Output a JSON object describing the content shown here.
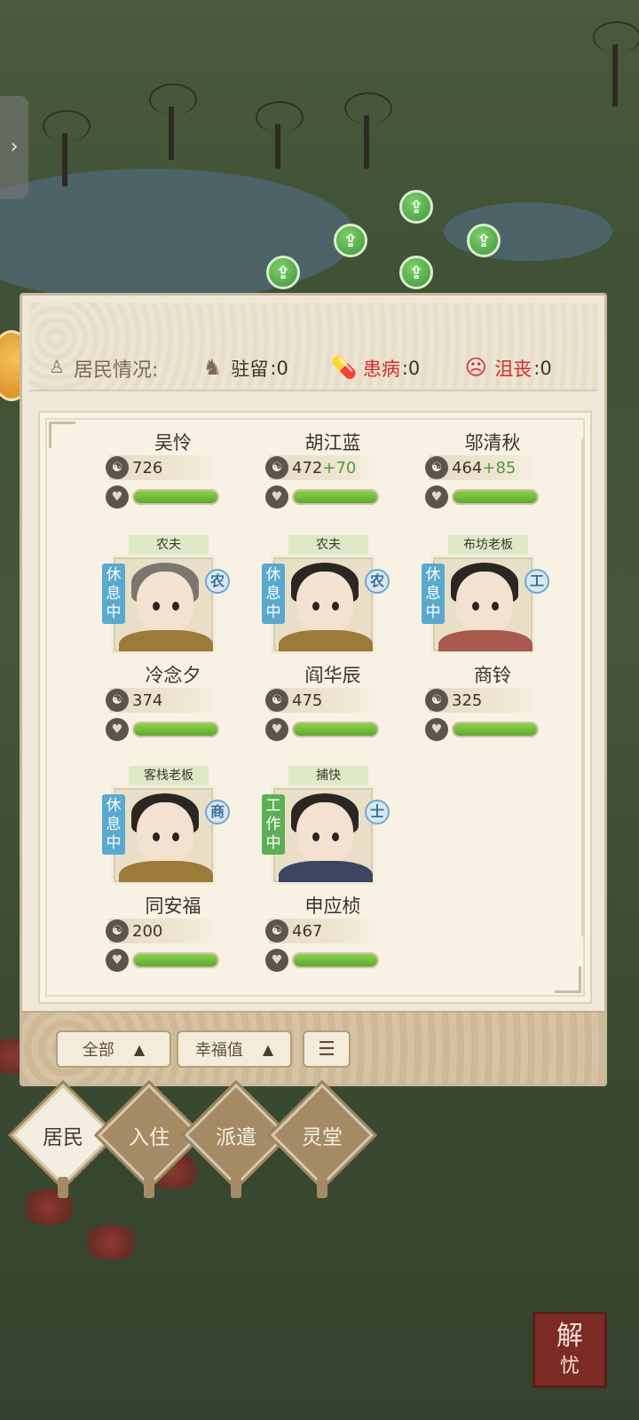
{
  "status": {
    "title": "居民情况:",
    "stay": {
      "label": "驻留",
      "value": ":0"
    },
    "sick": {
      "label": "患病",
      "value": ":0"
    },
    "sad": {
      "label": "沮丧",
      "value": ":0"
    }
  },
  "residents_top": [
    {
      "name": "吴怜",
      "happiness": "726",
      "bonus": "",
      "health": 1.0
    },
    {
      "name": "胡江蓝",
      "happiness": "472",
      "bonus": "+70",
      "health": 1.0
    },
    {
      "name": "邬清秋",
      "happiness": "464",
      "bonus": "+85",
      "health": 1.0
    }
  ],
  "residents": [
    {
      "name": "冷念夕",
      "job": "农夫",
      "state": "休息中",
      "class": "农",
      "happiness": "374",
      "health": 1.0
    },
    {
      "name": "阎华辰",
      "job": "农夫",
      "state": "休息中",
      "class": "农",
      "happiness": "475",
      "health": 1.0
    },
    {
      "name": "商铃",
      "job": "布坊老板",
      "state": "休息中",
      "class": "工",
      "happiness": "325",
      "health": 1.0
    },
    {
      "name": "同安福",
      "job": "客栈老板",
      "state": "休息中",
      "class": "商",
      "happiness": "200",
      "health": 1.0
    },
    {
      "name": "申应桢",
      "job": "捕快",
      "state": "工作中",
      "class": "士",
      "happiness": "467",
      "health": 1.0
    }
  ],
  "filters": {
    "all": "全部",
    "sort": "幸福值"
  },
  "nav": {
    "residents": "居民",
    "move_in": "入住",
    "dispatch": "派遣",
    "spirit_hall": "灵堂"
  },
  "seal": {
    "top": "解",
    "bottom": "忧"
  },
  "colors": {
    "health_fill": "#6cbb37",
    "rest_badge": "#5aa9cf",
    "work_badge": "#5daf55",
    "sick_text": "#d22d2d"
  }
}
